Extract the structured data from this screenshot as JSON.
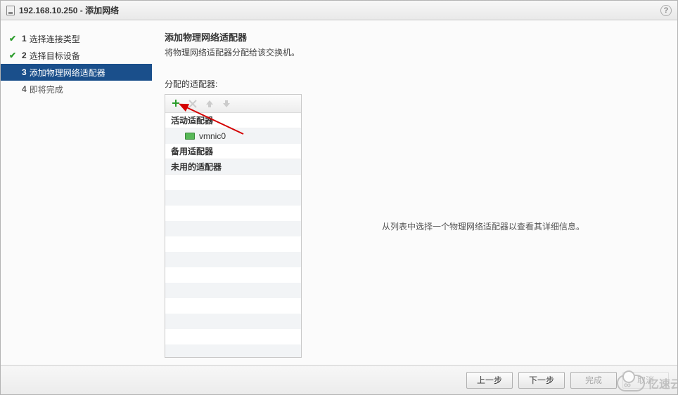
{
  "window": {
    "title": "192.168.10.250 - 添加网络",
    "help_tooltip": "?"
  },
  "steps": [
    {
      "num": "1",
      "label": "选择连接类型",
      "done": true,
      "active": false
    },
    {
      "num": "2",
      "label": "选择目标设备",
      "done": true,
      "active": false
    },
    {
      "num": "3",
      "label": "添加物理网络适配器",
      "done": false,
      "active": true
    },
    {
      "num": "4",
      "label": "即将完成",
      "done": false,
      "active": false
    }
  ],
  "content": {
    "title": "添加物理网络适配器",
    "subtitle": "将物理网络适配器分配给该交换机。",
    "section_label": "分配的适配器:",
    "groups": {
      "active": "活动适配器",
      "standby": "备用适配器",
      "unused": "未用的适配器"
    },
    "adapters": {
      "active": [
        {
          "name": "vmnic0"
        }
      ],
      "standby": [],
      "unused": []
    },
    "detail_placeholder": "从列表中选择一个物理网络适配器以查看其详细信息。"
  },
  "toolbar": {
    "add_icon": "add-icon",
    "remove_icon": "remove-icon",
    "up_icon": "arrow-up-icon",
    "down_icon": "arrow-down-icon"
  },
  "footer": {
    "back": "上一步",
    "next": "下一步",
    "finish": "完成",
    "cancel": "取消"
  },
  "watermark": "亿速云"
}
